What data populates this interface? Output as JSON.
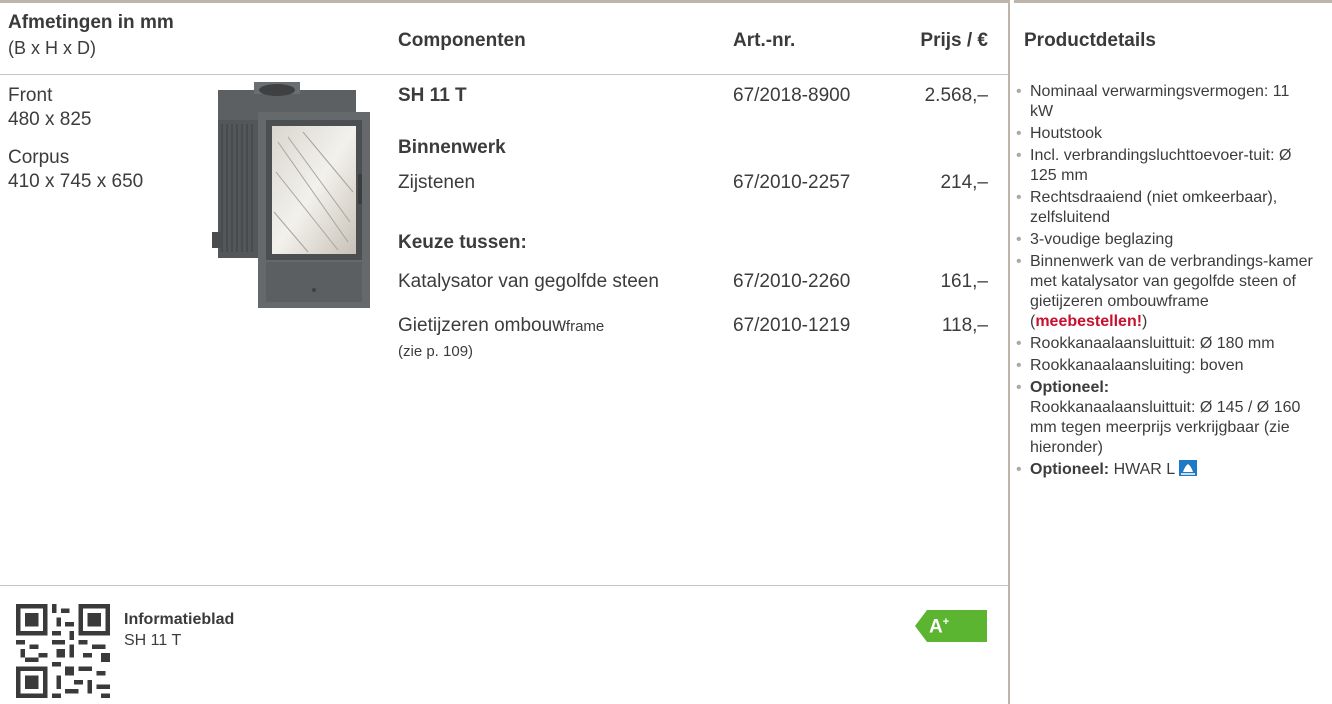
{
  "header": {
    "dim_title": "Afmetingen in mm",
    "dim_sub": "(B x H x D)",
    "components": "Componenten",
    "art": "Art.-nr.",
    "price": "Prijs / €",
    "details": "Productdetails"
  },
  "dimensions": {
    "front_label": "Front",
    "front_value": "480 x 825",
    "corpus_label": "Corpus",
    "corpus_value": "410 x 745 x 650"
  },
  "rows": {
    "main_name": "SH 11 T",
    "main_art": "67/2018-8900",
    "main_price": "2.568,–",
    "binnenwerk_heading": "Binnenwerk",
    "zijstenen_name": "Zijstenen",
    "zijstenen_art": "67/2010-2257",
    "zijstenen_price": "214,–",
    "keuze_heading": "Keuze tussen:",
    "kat_name": "Katalysator van gegolfde steen",
    "kat_art": "67/2010-2260",
    "kat_price": "161,–",
    "frame_name_a": "Gietijzeren ombouw",
    "frame_name_b": "frame",
    "frame_note": "(zie p. 109)",
    "frame_art": "67/2010-1219",
    "frame_price": "118,–"
  },
  "details": {
    "d1": "Nominaal verwarmingsvermogen: 11 kW",
    "d2": "Houtstook",
    "d3": "Incl. verbrandingsluchttoevoer-tuit: Ø 125 mm",
    "d4": "Rechtsdraaiend (niet omkeerbaar), zelfsluitend",
    "d5": "3-voudige beglazing",
    "d6": "Binnenwerk van de verbrandings-kamer met katalysator van gegolfde steen of gietijzeren ombouwframe (",
    "d6_red": "meebestellen!",
    "d6_end": ")",
    "d7": "Rookkanaalaansluittuit: Ø 180 mm",
    "d8": "Rookkanaalaansluiting: boven",
    "d9_bold": "Optioneel:",
    "d9": "Rookkanaalaansluittuit: Ø 145 / Ø 160 mm tegen meerprijs verkrijgbaar (zie hieronder)",
    "d10_bold": "Optioneel:",
    "d10": "HWAR L"
  },
  "footer": {
    "info_title": "Informatieblad",
    "info_sub": "SH 11 T",
    "energy_label": "A",
    "energy_sup": "+"
  },
  "colors": {
    "accent_red": "#c8102e",
    "energy_green": "#5cb531",
    "rule_gray": "#bdb5ab",
    "hwar_blue": "#1f79c4"
  }
}
